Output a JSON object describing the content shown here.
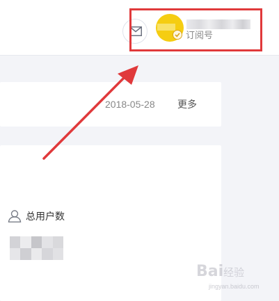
{
  "header": {
    "account_type": "订阅号",
    "icons": {
      "mail": "mail-icon",
      "verified": "check-icon"
    },
    "avatar_color": "#f5cd12"
  },
  "article_card": {
    "date": "2018-05-28",
    "more_label": "更多"
  },
  "stats_card": {
    "users_label": "总用户数",
    "icon": "user-icon"
  },
  "watermark": {
    "brand": "Bai",
    "brand_suffix": "经验",
    "url": "jingyan.baidu.com"
  },
  "annotation": {
    "color": "#e0393b"
  }
}
